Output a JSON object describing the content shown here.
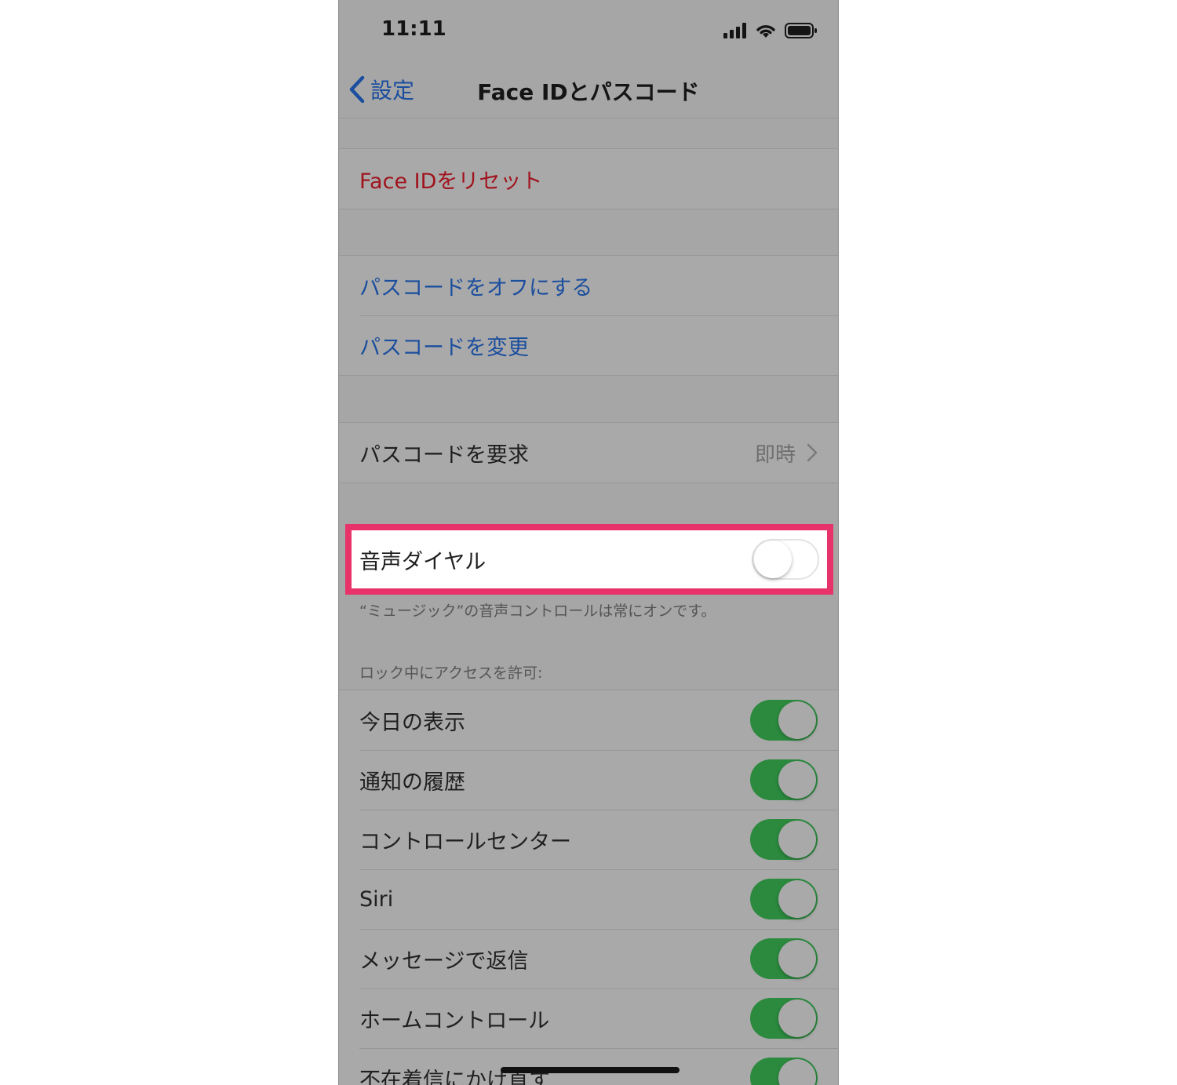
{
  "status": {
    "time": "11:11"
  },
  "nav": {
    "back_label": "設定",
    "title": "Face IDとパスコード"
  },
  "face_id": {
    "reset_label": "Face IDをリセット"
  },
  "passcode": {
    "turn_off_label": "パスコードをオフにする",
    "change_label": "パスコードを変更"
  },
  "require": {
    "label": "パスコードを要求",
    "value": "即時"
  },
  "voice_dial": {
    "label": "音声ダイヤル",
    "enabled": false,
    "footnote": "“ミュージック”の音声コントロールは常にオンです。"
  },
  "locked_access": {
    "header": "ロック中にアクセスを許可:",
    "items": [
      {
        "label": "今日の表示",
        "enabled": true
      },
      {
        "label": "通知の履歴",
        "enabled": true
      },
      {
        "label": "コントロールセンター",
        "enabled": true
      },
      {
        "label": "Siri",
        "enabled": true
      },
      {
        "label": "メッセージで返信",
        "enabled": true
      },
      {
        "label": "ホームコントロール",
        "enabled": true
      },
      {
        "label": "不在着信にかけ直す",
        "enabled": true
      }
    ]
  },
  "colors": {
    "highlight": "#e8336a",
    "toggle_on": "#2b8a3e",
    "link_blue": "#1b4e9e",
    "destructive_red": "#a0141e"
  }
}
